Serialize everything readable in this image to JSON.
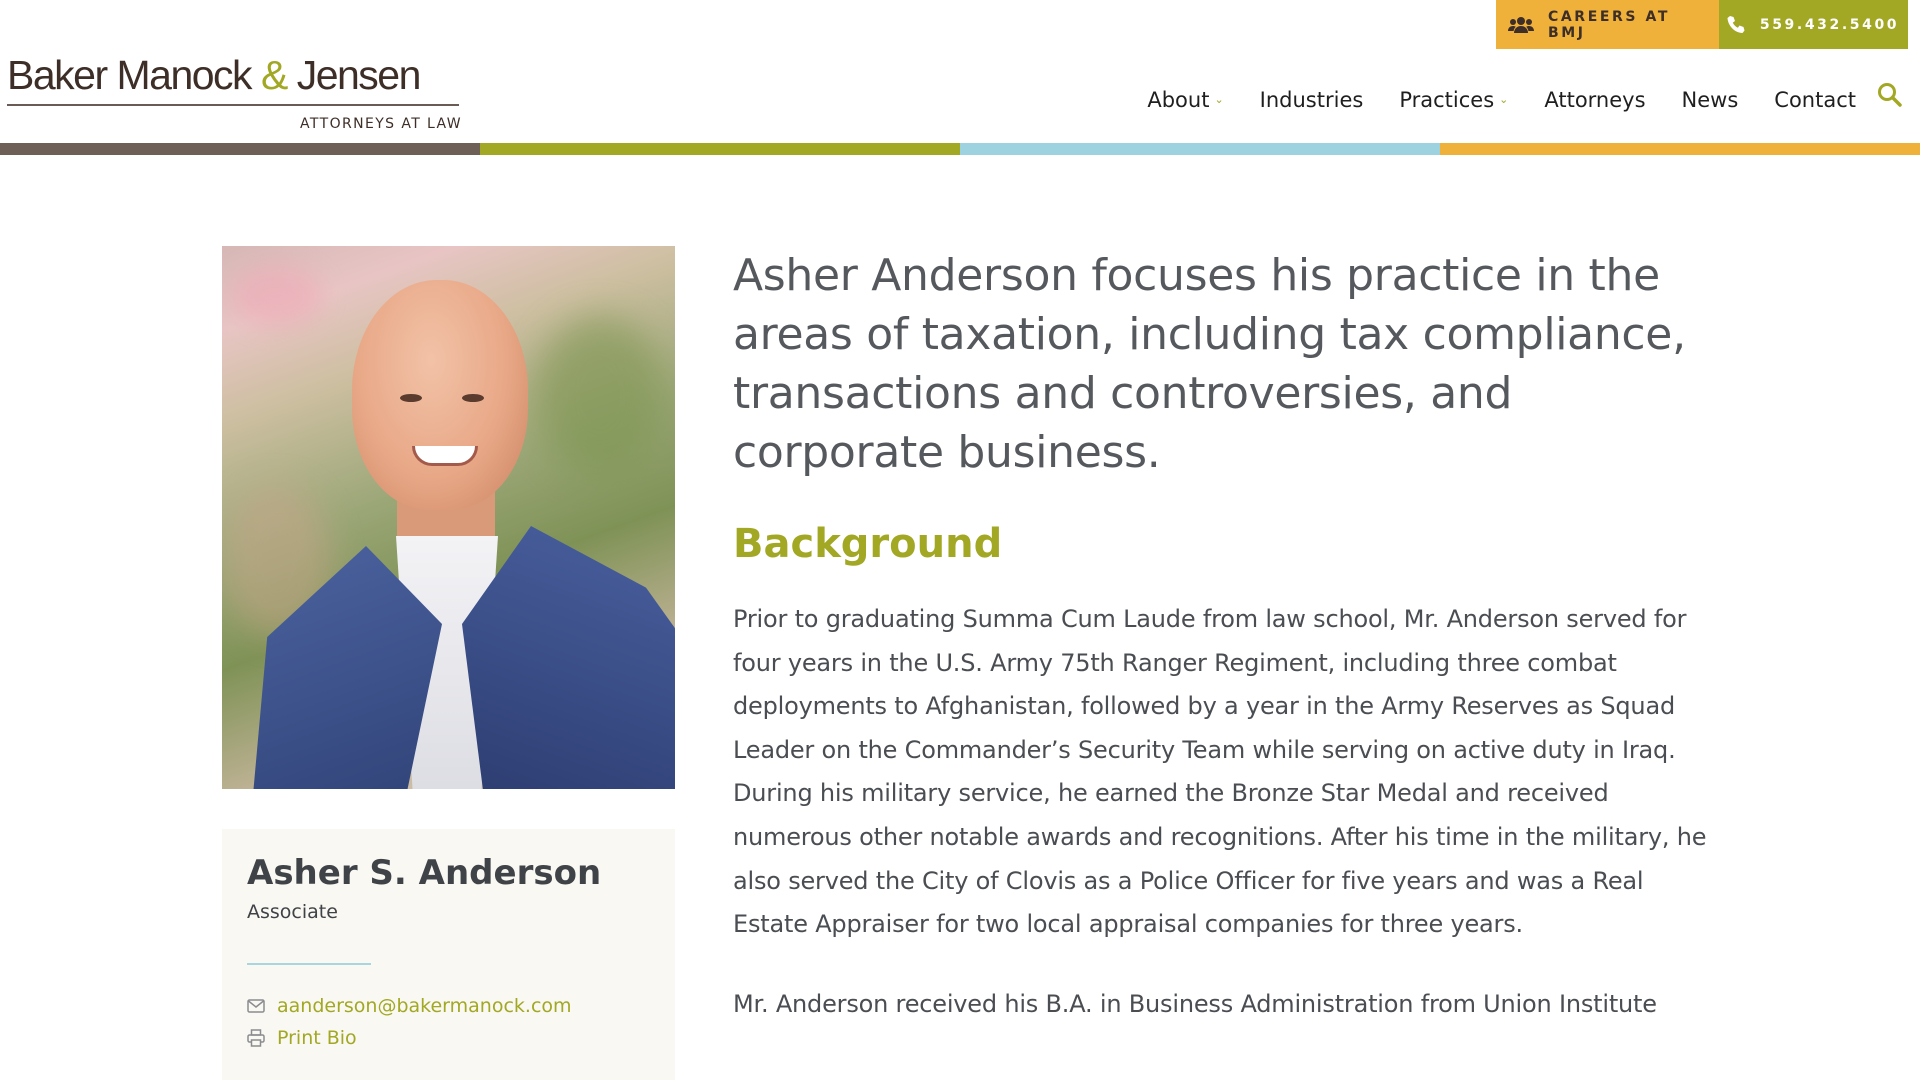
{
  "header": {
    "logo": {
      "name_part1": "Baker Manock ",
      "amp": "&",
      "name_part2": " Jensen",
      "subtitle": "ATTORNEYS AT LAW"
    },
    "top_bar": {
      "careers_label": "CAREERS AT BMJ",
      "phone_label": "559.432.5400"
    },
    "nav": [
      {
        "label": "About",
        "has_dropdown": true
      },
      {
        "label": "Industries",
        "has_dropdown": false
      },
      {
        "label": "Practices",
        "has_dropdown": true
      },
      {
        "label": "Attorneys",
        "has_dropdown": false
      },
      {
        "label": "News",
        "has_dropdown": false
      },
      {
        "label": "Contact",
        "has_dropdown": false
      }
    ],
    "dropdown_glyph": "⌄",
    "stripe_colors": [
      "#6f6057",
      "#a2a824",
      "#9fd2e0",
      "#f0b13a"
    ]
  },
  "profile": {
    "name": "Asher S. Anderson",
    "title": "Associate",
    "email": "aanderson@bakermanock.com",
    "print_label": "Print Bio"
  },
  "main": {
    "lead": "Asher Anderson focuses his practice in the areas of taxation, including tax compliance, transactions and controversies, and corporate business.",
    "background_heading": "Background",
    "paragraphs": [
      "Prior to graduating Summa Cum Laude from law school, Mr. Anderson served for four years in the U.S. Army 75th Ranger Regiment, including three combat deployments to Afghanistan, followed by a year in the Army Reserves as Squad Leader on the Commander’s Security Team while serving on active duty in Iraq. During his military service, he earned the Bronze Star Medal and received numerous other notable awards and recognitions. After his time in the military, he also served the City of Clovis as a Police Officer for five years and was a Real Estate Appraiser for two local appraisal companies for three years.",
      "Mr. Anderson received his B.A. in Business Administration from Union Institute"
    ]
  },
  "colors": {
    "accent_green": "#a2a824",
    "accent_orange": "#f0b13a",
    "accent_blue": "#9fd2e0",
    "brand_brown": "#3d2e27"
  },
  "icons": [
    "users-icon",
    "phone-icon",
    "search-icon",
    "envelope-icon",
    "printer-icon",
    "chevron-down-icon"
  ]
}
